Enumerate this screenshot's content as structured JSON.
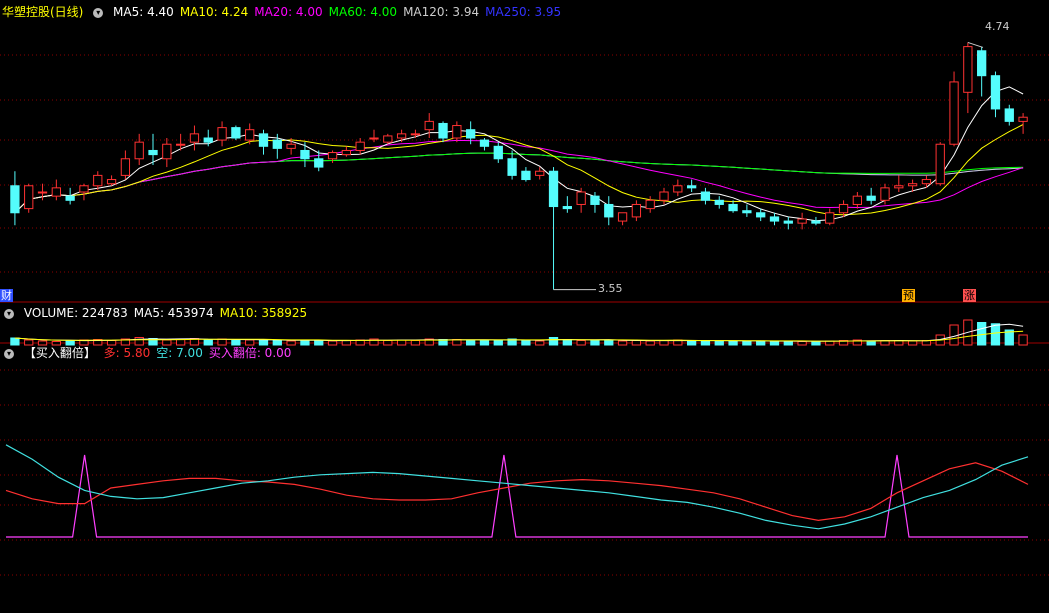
{
  "panels": {
    "price": {
      "title": "华塑控股(日线)",
      "ma_labels": [
        {
          "text": "MA5: 4.40",
          "color": "#ffffff"
        },
        {
          "text": "MA10: 4.24",
          "color": "#ffff00"
        },
        {
          "text": "MA20: 4.00",
          "color": "#ff00ff"
        },
        {
          "text": "MA60: 4.00",
          "color": "#00ff00"
        },
        {
          "text": "MA120: 3.94",
          "color": "#cccccc"
        },
        {
          "text": "MA250: 3.95",
          "color": "#3333ff"
        }
      ],
      "high_label": "4.74",
      "low_label": "3.55",
      "marker_left": "财",
      "marker_yu": "预",
      "marker_zhang": "涨"
    },
    "volume": {
      "labels": [
        {
          "text": "VOLUME: 224783",
          "color": "#ffffff"
        },
        {
          "text": "MA5: 453974",
          "color": "#ffffff"
        },
        {
          "text": "MA10: 358925",
          "color": "#ffff00"
        }
      ]
    },
    "indicator": {
      "name": "【买入翻倍】",
      "labels": [
        {
          "text": "多: 5.80",
          "color": "#ff3030"
        },
        {
          "text": "空: 7.00",
          "color": "#40e0e0"
        },
        {
          "text": "买入翻倍: 0.00",
          "color": "#ff40ff"
        }
      ]
    }
  },
  "colors": {
    "up": "#ff3232",
    "down": "#54fcfc",
    "grid": "#8b0000",
    "border": "#a00000"
  },
  "chart_data": [
    {
      "type": "candlestick",
      "title": "华塑控股(日线)",
      "ylim": [
        3.5,
        4.8
      ],
      "candles": [
        [
          4.05,
          4.12,
          3.86,
          3.92
        ],
        [
          3.94,
          4.06,
          3.92,
          4.05
        ],
        [
          4.02,
          4.06,
          3.98,
          4.02
        ],
        [
          4.0,
          4.08,
          3.98,
          4.04
        ],
        [
          4.0,
          4.04,
          3.96,
          3.98
        ],
        [
          4.02,
          4.06,
          3.98,
          4.05
        ],
        [
          4.05,
          4.12,
          4.03,
          4.1
        ],
        [
          4.06,
          4.1,
          4.05,
          4.08
        ],
        [
          4.1,
          4.22,
          4.08,
          4.18
        ],
        [
          4.18,
          4.3,
          4.15,
          4.26
        ],
        [
          4.22,
          4.3,
          4.15,
          4.2
        ],
        [
          4.18,
          4.28,
          4.14,
          4.25
        ],
        [
          4.25,
          4.3,
          4.22,
          4.25
        ],
        [
          4.26,
          4.34,
          4.22,
          4.3
        ],
        [
          4.28,
          4.32,
          4.24,
          4.26
        ],
        [
          4.27,
          4.36,
          4.24,
          4.33
        ],
        [
          4.33,
          4.34,
          4.27,
          4.28
        ],
        [
          4.27,
          4.35,
          4.25,
          4.32
        ],
        [
          4.3,
          4.32,
          4.2,
          4.24
        ],
        [
          4.27,
          4.3,
          4.18,
          4.23
        ],
        [
          4.23,
          4.28,
          4.2,
          4.25
        ],
        [
          4.22,
          4.26,
          4.14,
          4.18
        ],
        [
          4.18,
          4.22,
          4.12,
          4.14
        ],
        [
          4.18,
          4.22,
          4.16,
          4.21
        ],
        [
          4.2,
          4.24,
          4.19,
          4.22
        ],
        [
          4.22,
          4.28,
          4.2,
          4.26
        ],
        [
          4.28,
          4.32,
          4.26,
          4.28
        ],
        [
          4.26,
          4.3,
          4.25,
          4.29
        ],
        [
          4.28,
          4.32,
          4.26,
          4.3
        ],
        [
          4.3,
          4.32,
          4.28,
          4.3
        ],
        [
          4.32,
          4.4,
          4.28,
          4.36
        ],
        [
          4.35,
          4.36,
          4.26,
          4.28
        ],
        [
          4.28,
          4.36,
          4.26,
          4.34
        ],
        [
          4.32,
          4.36,
          4.25,
          4.28
        ],
        [
          4.27,
          4.28,
          4.22,
          4.24
        ],
        [
          4.24,
          4.26,
          4.16,
          4.18
        ],
        [
          4.18,
          4.22,
          4.08,
          4.1
        ],
        [
          4.12,
          4.14,
          4.07,
          4.08
        ],
        [
          4.1,
          4.14,
          4.08,
          4.12
        ],
        [
          4.12,
          4.14,
          3.55,
          3.95
        ],
        [
          3.95,
          4.0,
          3.92,
          3.94
        ],
        [
          3.96,
          4.04,
          3.92,
          4.02
        ],
        [
          4.0,
          4.02,
          3.92,
          3.96
        ],
        [
          3.96,
          4.0,
          3.86,
          3.9
        ],
        [
          3.88,
          3.92,
          3.86,
          3.92
        ],
        [
          3.9,
          3.98,
          3.88,
          3.96
        ],
        [
          3.94,
          4.0,
          3.92,
          3.98
        ],
        [
          3.98,
          4.04,
          3.96,
          4.02
        ],
        [
          4.02,
          4.08,
          4.0,
          4.05
        ],
        [
          4.05,
          4.08,
          4.02,
          4.04
        ],
        [
          4.02,
          4.04,
          3.96,
          3.98
        ],
        [
          3.98,
          4.0,
          3.94,
          3.96
        ],
        [
          3.96,
          3.98,
          3.92,
          3.93
        ],
        [
          3.93,
          3.96,
          3.9,
          3.92
        ],
        [
          3.92,
          3.94,
          3.88,
          3.9
        ],
        [
          3.9,
          3.92,
          3.86,
          3.88
        ],
        [
          3.88,
          3.9,
          3.84,
          3.87
        ],
        [
          3.87,
          3.92,
          3.84,
          3.89
        ],
        [
          3.88,
          3.9,
          3.86,
          3.87
        ],
        [
          3.87,
          3.94,
          3.86,
          3.92
        ],
        [
          3.92,
          3.98,
          3.9,
          3.96
        ],
        [
          3.96,
          4.02,
          3.94,
          4.0
        ],
        [
          4.0,
          4.04,
          3.96,
          3.98
        ],
        [
          3.98,
          4.06,
          3.96,
          4.04
        ],
        [
          4.04,
          4.1,
          4.02,
          4.05
        ],
        [
          4.05,
          4.08,
          4.02,
          4.06
        ],
        [
          4.06,
          4.1,
          4.04,
          4.08
        ],
        [
          4.06,
          4.26,
          4.05,
          4.25
        ],
        [
          4.25,
          4.6,
          4.24,
          4.55
        ],
        [
          4.5,
          4.74,
          4.4,
          4.72
        ],
        [
          4.7,
          4.72,
          4.48,
          4.58
        ],
        [
          4.58,
          4.6,
          4.38,
          4.42
        ],
        [
          4.42,
          4.44,
          4.34,
          4.36
        ],
        [
          4.36,
          4.4,
          4.3,
          4.38
        ]
      ]
    },
    {
      "type": "bar",
      "title": "VOLUME",
      "volumes": [
        0.28,
        0.2,
        0.16,
        0.14,
        0.18,
        0.2,
        0.22,
        0.18,
        0.24,
        0.3,
        0.26,
        0.2,
        0.22,
        0.26,
        0.2,
        0.24,
        0.18,
        0.2,
        0.22,
        0.18,
        0.16,
        0.2,
        0.18,
        0.16,
        0.18,
        0.2,
        0.24,
        0.18,
        0.2,
        0.18,
        0.24,
        0.22,
        0.22,
        0.2,
        0.18,
        0.2,
        0.24,
        0.18,
        0.16,
        0.3,
        0.22,
        0.18,
        0.18,
        0.2,
        0.16,
        0.18,
        0.16,
        0.18,
        0.2,
        0.16,
        0.18,
        0.16,
        0.16,
        0.16,
        0.16,
        0.14,
        0.16,
        0.14,
        0.14,
        0.16,
        0.18,
        0.2,
        0.16,
        0.18,
        0.18,
        0.16,
        0.18,
        0.4,
        0.8,
        1.0,
        0.9,
        0.85,
        0.6,
        0.4
      ]
    },
    {
      "type": "line",
      "title": "【买入翻倍】",
      "ylim": [
        0,
        10
      ],
      "series": [
        {
          "name": "多",
          "color": "#ff3030",
          "values": [
            6.8,
            6.1,
            5.7,
            5.7,
            7.0,
            7.3,
            7.6,
            7.8,
            7.8,
            7.6,
            7.5,
            7.3,
            6.9,
            6.4,
            6.1,
            6.0,
            6.0,
            6.1,
            6.6,
            7.0,
            7.4,
            7.6,
            7.7,
            7.6,
            7.4,
            7.2,
            6.9,
            6.6,
            6.1,
            5.4,
            4.7,
            4.3,
            4.6,
            5.3,
            6.6,
            7.6,
            8.6,
            9.1,
            8.4,
            7.3
          ]
        },
        {
          "name": "空",
          "color": "#40e0e0",
          "values": [
            10.6,
            9.4,
            7.9,
            6.8,
            6.3,
            6.1,
            6.2,
            6.6,
            7.0,
            7.4,
            7.6,
            7.9,
            8.1,
            8.2,
            8.3,
            8.2,
            8.0,
            7.8,
            7.6,
            7.4,
            7.2,
            7.0,
            6.8,
            6.6,
            6.3,
            6.0,
            5.8,
            5.4,
            4.9,
            4.3,
            3.9,
            3.6,
            4.0,
            4.6,
            5.4,
            6.2,
            6.8,
            7.7,
            8.9,
            9.6
          ]
        },
        {
          "name": "买入翻倍",
          "color": "#ff40ff",
          "signal_values": [
            0,
            0,
            0,
            10,
            0,
            0,
            0,
            0,
            0,
            0,
            0,
            0,
            0,
            0,
            0,
            0,
            0,
            0,
            0,
            10,
            0,
            0,
            0,
            0,
            0,
            0,
            0,
            0,
            0,
            0,
            0,
            0,
            0,
            0,
            10,
            0,
            0,
            0,
            0,
            0
          ]
        }
      ]
    }
  ]
}
